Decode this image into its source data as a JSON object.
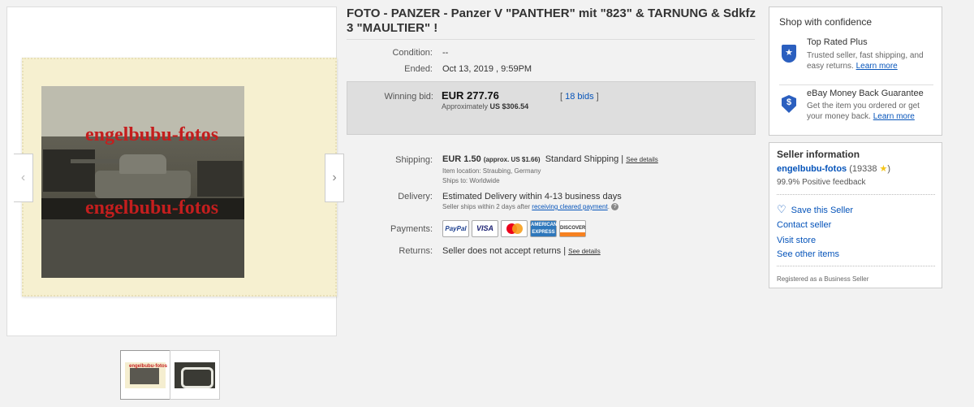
{
  "gallery": {
    "watermark_1": "engelbubu-fotos",
    "watermark_2": "engelbubu-fotos",
    "prev_arrow": "‹",
    "next_arrow": "›",
    "thumb_watermark": "engelbubu-fotos"
  },
  "listing": {
    "title": "FOTO - PANZER - Panzer V \"PANTHER\" mit \"823\" & TARNUNG & Sdkfz 3 \"MAULTIER\" !",
    "condition_label": "Condition:",
    "condition_value": "--",
    "ended_label": "Ended:",
    "ended_value": "Oct 13, 2019 , 9:59PM",
    "winning_bid_label": "Winning bid:",
    "bid_amount": "EUR 277.76",
    "bid_approx_prefix": "Approximately",
    "bid_approx_value": "US $306.54",
    "bids_open": "[",
    "bids_link": "18 bids",
    "bids_close": "]",
    "shipping_label": "Shipping:",
    "shipping_amount": "EUR 1.50",
    "shipping_approx": "(approx. US $1.66)",
    "shipping_method": "Standard Shipping |",
    "see_details": "See details",
    "item_location": "Item location:  Straubing, Germany",
    "ships_to": "Ships to:  Worldwide",
    "delivery_label": "Delivery:",
    "delivery_value": "Estimated Delivery within 4-13 business days",
    "delivery_note_prefix": "Seller ships within 2 days after",
    "delivery_note_link": "receiving cleared payment",
    "delivery_note_suffix": ".",
    "help_icon": "?",
    "payments_label": "Payments:",
    "pay_paypal": "PayPal",
    "pay_visa": "VISA",
    "pay_amex": "AMERICAN EXPRESS",
    "pay_discover": "DISCOVER",
    "returns_label": "Returns:",
    "returns_value": "Seller does not accept returns |",
    "returns_see_details": "See details"
  },
  "confidence": {
    "heading": "Shop with confidence",
    "top_rated_title": "Top Rated Plus",
    "top_rated_desc": "Trusted seller, fast shipping, and easy returns.",
    "top_rated_link": "Learn more",
    "top_rated_icon": "★",
    "guarantee_title": "eBay Money Back Guarantee",
    "guarantee_desc": "Get the item you ordered or get your money back.",
    "guarantee_link": "Learn more",
    "guarantee_icon": "$"
  },
  "seller": {
    "heading": "Seller information",
    "name": "engelbubu-fotos",
    "score_open": "(19338",
    "score_star": "★",
    "score_close": ")",
    "feedback": "99.9% Positive feedback",
    "save_icon": "♡",
    "save_seller": "Save this Seller",
    "contact": "Contact seller",
    "visit_store": "Visit store",
    "other_items": "See other items",
    "registered": "Registered as a Business Seller"
  },
  "colors": {
    "link": "#0654ba",
    "watermark": "#c41e1e",
    "bid_box": "#dedede",
    "badge": "#2b5fbf"
  }
}
